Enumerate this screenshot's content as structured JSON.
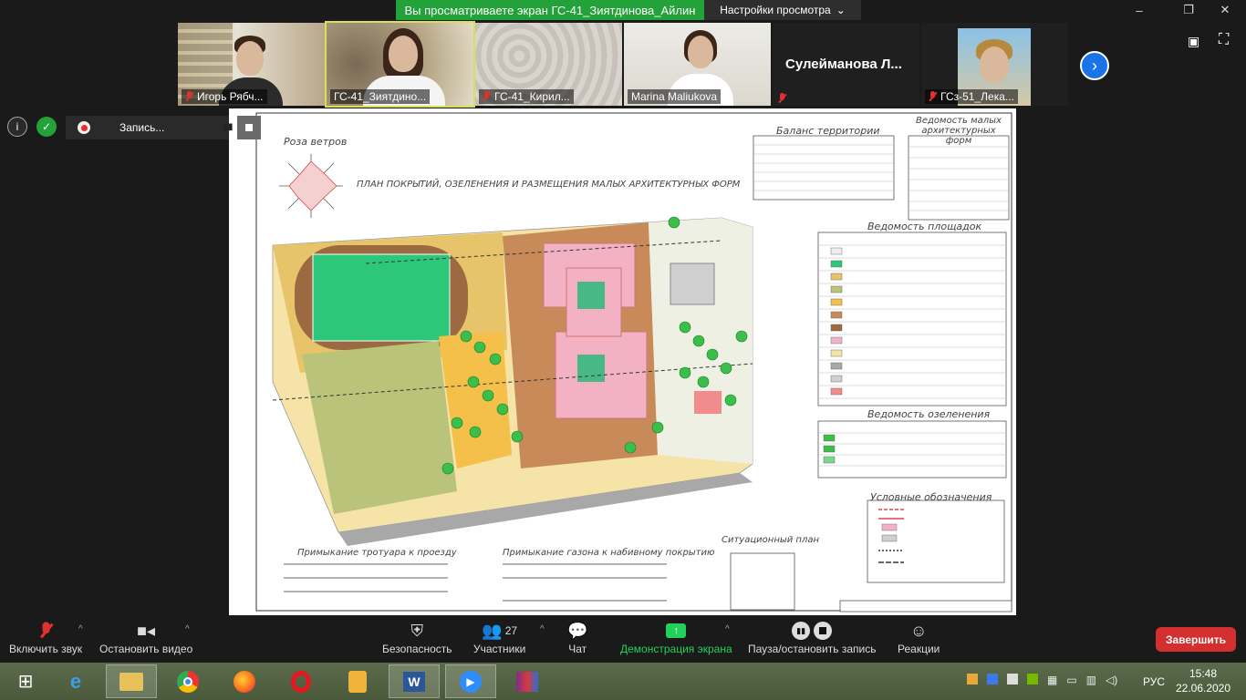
{
  "banner": {
    "text": "Вы просматриваете экран ГС-41_Зиятдинова_Айлин",
    "settings": "Настройки просмотра"
  },
  "window": {
    "minimize": "–",
    "restore": "❐",
    "close": "✕"
  },
  "participants": [
    {
      "name": "Игорь Рябч...",
      "muted": true
    },
    {
      "name": "ГС-41_Зиятдино...",
      "muted": false,
      "active": true
    },
    {
      "name": "ГС-41_Кирил...",
      "muted": true
    },
    {
      "name": "Marina Maliukova",
      "muted": false
    },
    {
      "name": "Сулейманова Л...",
      "muted": true,
      "no_video": true
    },
    {
      "name": "ГСз-51_Лека...",
      "muted": true
    }
  ],
  "meeting": {
    "recording_label": "Запись..."
  },
  "drawing": {
    "title": "ПЛАН ПОКРЫТИЙ, ОЗЕЛЕНЕНИЯ И РАЗМЕЩЕНИЯ МАЛЫХ АРХИТЕКТУРНЫХ ФОРМ",
    "wind_rose": "Роза ветров",
    "balance": "Баланс территории",
    "maf": "Ведомость малых архитектурных форм",
    "sites": "Ведомость площадок",
    "greening": "Ведомость озеленения",
    "legend": "Условные обозначения",
    "sidewalk": "Примыкание тротуара к проезду",
    "lawn": "Примыкание газона к набивному покрытию",
    "situation": "Ситуационный план"
  },
  "toolbar": {
    "unmute": "Включить звук",
    "stop_video": "Остановить видео",
    "security": "Безопасность",
    "participants": "Участники",
    "participants_count": "27",
    "chat": "Чат",
    "share": "Демонстрация экрана",
    "pause_record": "Пауза/остановить запись",
    "reactions": "Реакции",
    "end": "Завершить"
  },
  "taskbar": {
    "lang": "РУС",
    "time": "15:48",
    "date": "22.06.2020"
  },
  "colors": {
    "banner": "#23a23a",
    "end": "#d32f2f",
    "accent": "#1a73e8",
    "share_active": "#23d05a"
  }
}
